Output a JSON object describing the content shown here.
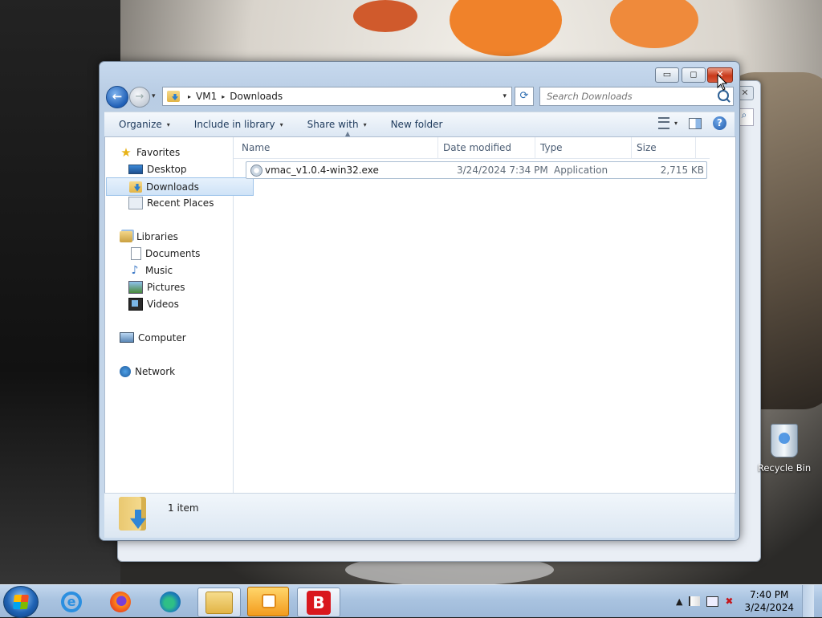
{
  "window": {
    "title_buttons": {
      "minimize": "▭",
      "maximize": "◻",
      "close": "✕"
    },
    "nav": {
      "back_icon": "←",
      "forward_icon": "→",
      "dropdown": "▾"
    },
    "address": {
      "crumbs": [
        "VM1",
        "Downloads"
      ],
      "separator": "▸",
      "dropdown": "▾"
    },
    "refresh_icon": "⟳",
    "search": {
      "placeholder": "Search Downloads"
    },
    "toolbar": {
      "organize": "Organize",
      "include_in_library": "Include in library",
      "share_with": "Share with",
      "new_folder": "New folder",
      "caret": "▾",
      "help": "?"
    },
    "navpane": {
      "favorites": "Favorites",
      "desktop": "Desktop",
      "downloads": "Downloads",
      "recent_places": "Recent Places",
      "libraries": "Libraries",
      "documents": "Documents",
      "music": "Music",
      "pictures": "Pictures",
      "videos": "Videos",
      "computer": "Computer",
      "network": "Network"
    },
    "columns": {
      "name": "Name",
      "date_modified": "Date modified",
      "type": "Type",
      "size": "Size"
    },
    "files": [
      {
        "name": "vmac_v1.0.4-win32.exe",
        "date": "3/24/2024 7:34 PM",
        "type": "Application",
        "size": "2,715 KB"
      }
    ],
    "status": {
      "count": "1 item"
    }
  },
  "desktop": {
    "recycle_bin": "Recycle Bin"
  },
  "taskbar": {
    "b_app": "B",
    "ie_glyph": "e",
    "clock_time": "7:40 PM",
    "clock_date": "3/24/2024",
    "tray_expand": "▲"
  },
  "colors": {
    "accent": "#1f5fb6",
    "close": "#c8391a",
    "taskbar": "#a9c3e0"
  }
}
